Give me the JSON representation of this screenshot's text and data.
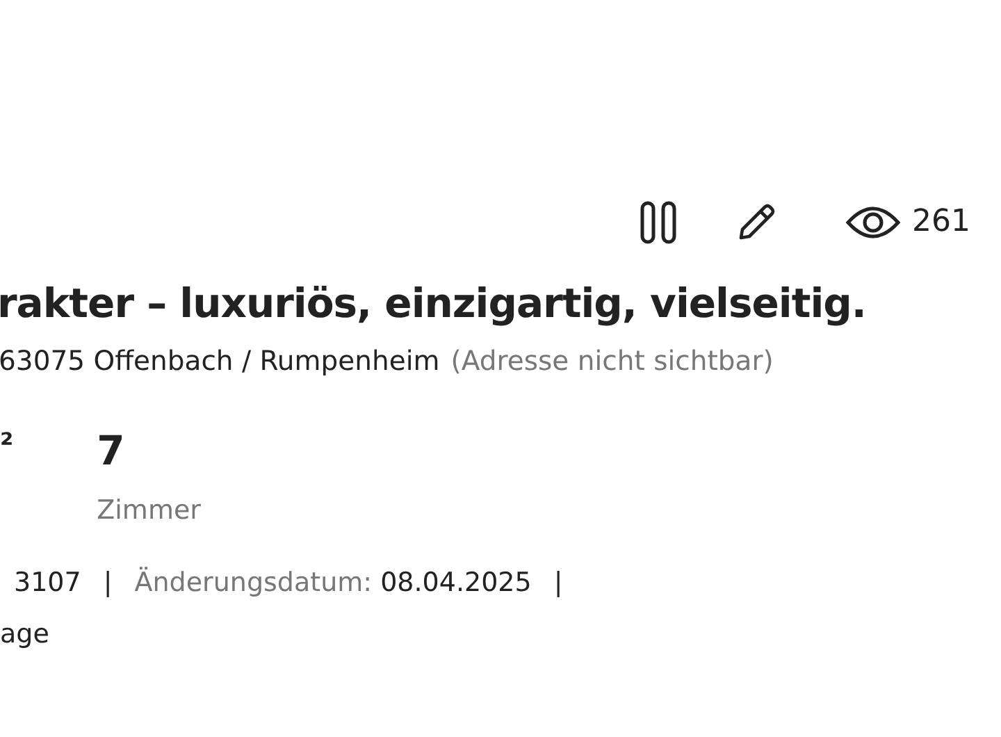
{
  "toolbar": {
    "views": "261"
  },
  "title": "rakter – luxuriös, einzigartig, vielseitig.",
  "address": {
    "location": "63075 Offenbach / Rumpenheim",
    "note": "(Adresse nicht sichtbar)"
  },
  "facts": [
    {
      "value": "²"
    },
    {
      "value": "7",
      "label": "Zimmer"
    }
  ],
  "meta": {
    "id_value": "3107",
    "separator_1": "|",
    "changed_label": "Änderungsdatum:",
    "changed_value": "08.04.2025",
    "separator_2": "|"
  },
  "meta_line_2": "age"
}
